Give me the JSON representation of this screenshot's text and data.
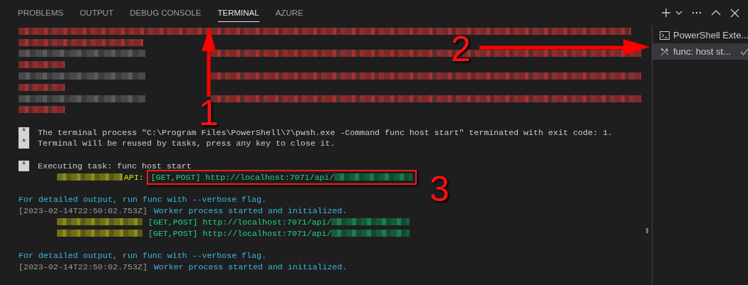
{
  "panel_tabs": [
    {
      "label": "PROBLEMS",
      "selected": false
    },
    {
      "label": "OUTPUT",
      "selected": false
    },
    {
      "label": "DEBUG CONSOLE",
      "selected": false
    },
    {
      "label": "TERMINAL",
      "selected": true
    },
    {
      "label": "AZURE",
      "selected": false
    }
  ],
  "terminal_list": [
    {
      "kind": "shell",
      "label": "PowerShell Exte...",
      "selected": false,
      "checked": false
    },
    {
      "kind": "task",
      "label": "func: host st...",
      "selected": true,
      "checked": true
    }
  ],
  "terminal_lines": [
    {
      "kind": "redacted_full"
    },
    {
      "kind": "redacted_wrap"
    },
    {
      "kind": "redacted_pair"
    },
    {
      "kind": "redacted_short"
    },
    {
      "kind": "redacted_pair"
    },
    {
      "kind": "redacted_short"
    },
    {
      "kind": "redacted_pair"
    },
    {
      "kind": "redacted_short"
    },
    {
      "kind": "blank"
    },
    {
      "kind": "task",
      "badge": "*",
      "text": "The terminal process \"C:\\Program Files\\PowerShell\\7\\pwsh.exe -Command func host start\" terminated with exit code: 1."
    },
    {
      "kind": "task",
      "badge": "*",
      "text": "Terminal will be reused by tasks, press any key to close it."
    },
    {
      "kind": "blank"
    },
    {
      "kind": "task",
      "badge": "*",
      "text": "Executing task: func host start"
    },
    {
      "kind": "api",
      "label": "API:",
      "route": "[GET,POST] http://localhost:7071/api/",
      "highlighted": true
    },
    {
      "kind": "blank"
    },
    {
      "kind": "info",
      "text": "For detailed output, run func with --verbose flag."
    },
    {
      "kind": "log",
      "timestamp": "[2023-02-14T22:50:02.753Z]",
      "text": "Worker process started and initialized."
    },
    {
      "kind": "route",
      "route": "[GET,POST] http://localhost:7071/api/"
    },
    {
      "kind": "route",
      "route": "[GET,POST] http://localhost:7071/api/"
    },
    {
      "kind": "blank"
    },
    {
      "kind": "info",
      "text": "For detailed output, run func with --verbose flag."
    },
    {
      "kind": "log",
      "timestamp": "[2023-02-14T22:50:02.753Z]",
      "text": "Worker process started and initialized."
    }
  ],
  "annotations": [
    {
      "kind": "arrow_up",
      "label": "1"
    },
    {
      "kind": "arrow_right",
      "label": "2"
    },
    {
      "kind": "callout",
      "label": "3"
    }
  ]
}
